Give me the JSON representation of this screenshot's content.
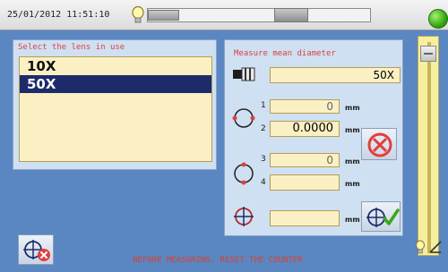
{
  "topbar": {
    "datetime": "25/01/2012  11:51:10",
    "progress_fraction": 0.14
  },
  "lens_panel": {
    "title": "Select the lens in use",
    "items": [
      {
        "label": "10X",
        "selected": false
      },
      {
        "label": "50X",
        "selected": true
      }
    ]
  },
  "measure_panel": {
    "title": "Measure mean diameter",
    "objective_value": "50X",
    "field1_value": "0",
    "field2_value": "0.0000",
    "field3_value": "0",
    "field4_value": "",
    "field5_value": "",
    "unit": "mm",
    "index_labels": [
      "1",
      "2",
      "3",
      "4"
    ]
  },
  "status_message": "BEFORE MEASURING, RESET THE COUNTER",
  "icons": {
    "status_led": "green-led-icon",
    "bulb": "bulb-icon",
    "objective": "objective-lens-icon",
    "diameter1": "diameter-circle-icon",
    "diameter2": "diameter-circle-rotated-icon",
    "crosshair": "crosshair-target-icon",
    "cancel": "cancel-x-circle-icon",
    "confirm": "confirm-crosshair-check-icon",
    "exit": "exit-crosshair-icon"
  },
  "colors": {
    "background": "#5a86c2",
    "panel": "#cfe0f2",
    "field": "#faf0c3",
    "selected": "#1e2b6b",
    "label_red": "#e0403c",
    "led_green": "#36a813"
  }
}
